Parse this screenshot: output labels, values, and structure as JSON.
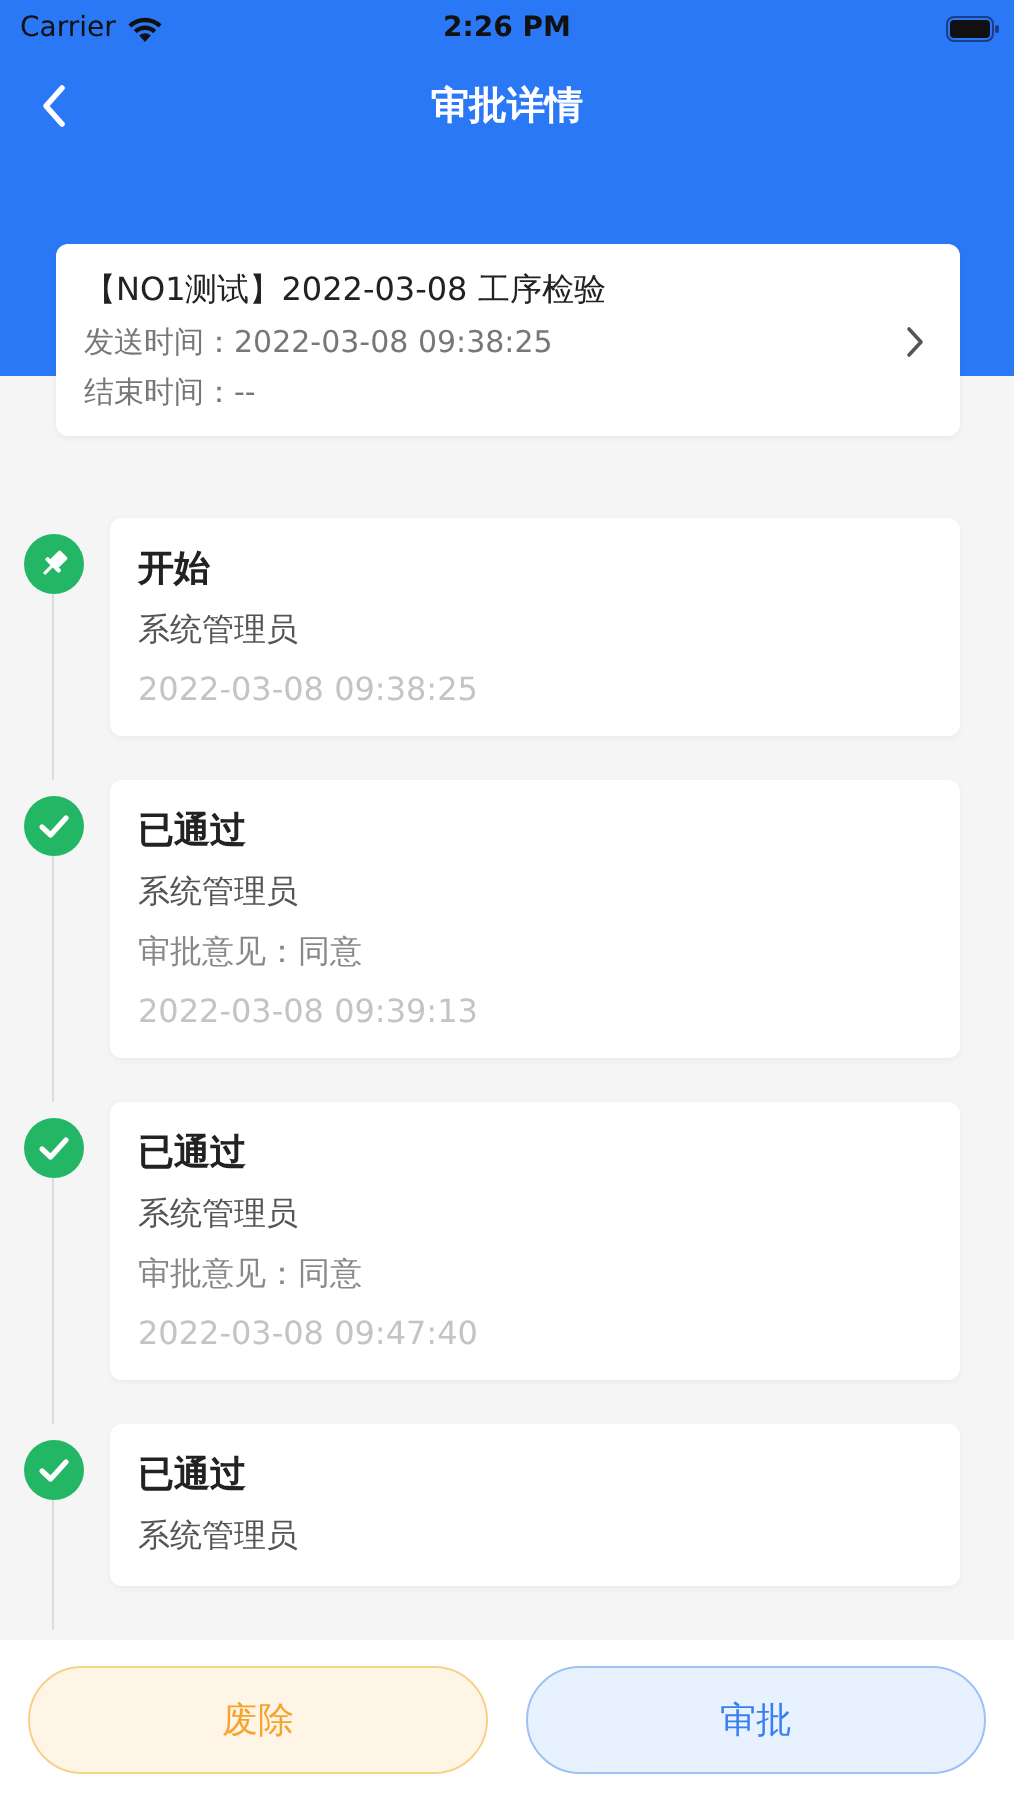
{
  "status_bar": {
    "carrier": "Carrier",
    "time": "2:26 PM"
  },
  "nav": {
    "title": "审批详情"
  },
  "summary": {
    "title": "【NO1测试】2022-03-08 工序检验",
    "send_time": "发送时间：2022-03-08 09:38:25",
    "end_time": "结束时间：--"
  },
  "timeline": [
    {
      "kind": "start",
      "title": "开始",
      "person": "系统管理员",
      "time": "2022-03-08 09:38:25"
    },
    {
      "kind": "passed",
      "title": "已通过",
      "person": "系统管理员",
      "opinion": "审批意见：同意",
      "time": "2022-03-08 09:39:13"
    },
    {
      "kind": "passed",
      "title": "已通过",
      "person": "系统管理员",
      "opinion": "审批意见：同意",
      "time": "2022-03-08 09:47:40"
    },
    {
      "kind": "passed",
      "title": "已通过",
      "person": "系统管理员"
    }
  ],
  "buttons": [
    {
      "kind": "warning",
      "label": "废除"
    },
    {
      "kind": "primary",
      "label": "审批"
    }
  ]
}
